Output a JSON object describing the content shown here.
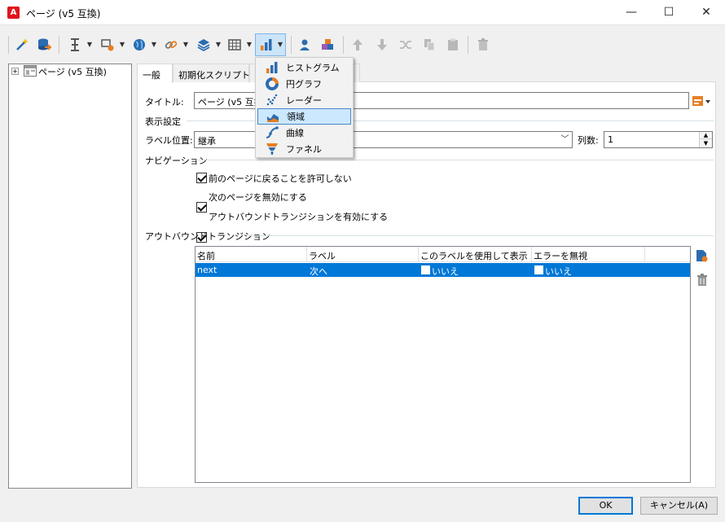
{
  "window": {
    "title": "ページ (v5 互換)",
    "minimize": "—",
    "maximize": "☐",
    "close": "✕"
  },
  "toolbar": {
    "icons": [
      "wand-icon",
      "database-icon",
      "text-cursor-icon",
      "shapes-icon",
      "globe-icon",
      "link-icon",
      "layers-icon",
      "grid-icon",
      "bar-chart-icon",
      "person-icon",
      "puzzle-icon",
      "arrow-up-icon",
      "arrow-down-icon",
      "shuffle-icon",
      "copy-icon",
      "paste-icon",
      "trash-icon"
    ]
  },
  "tree": {
    "root_label": "ページ (v5 互換)",
    "expander": "+"
  },
  "tabs": [
    {
      "label": "一般",
      "active": true
    },
    {
      "label": "初期化スクリプト",
      "active": false
    }
  ],
  "form": {
    "title_label": "タイトル:",
    "title_value": "ページ (v5 互換)",
    "display_group": "表示設定",
    "label_position_label": "ラベル位置:",
    "label_position_value": "継承",
    "columns_label": "列数:",
    "columns_value": "1",
    "nav_group": "ナビゲーション",
    "checkboxes": [
      {
        "label": "前のページに戻ることを許可しない",
        "checked": true
      },
      {
        "label": "次のページを無効にする",
        "checked": true
      },
      {
        "label": "アウトバウンドトランジションを有効にする",
        "checked": true
      }
    ],
    "outbound_group": "アウトバウンドトランジション"
  },
  "grid": {
    "columns": [
      "名前",
      "ラベル",
      "このラベルを使用して表示",
      "エラーを無視"
    ],
    "rows": [
      {
        "name": "next",
        "label": "次へ",
        "use_label": "いいえ",
        "ignore_errors": "いいえ"
      }
    ]
  },
  "menu": {
    "items": [
      {
        "label": "ヒストグラム",
        "icon": "histogram-icon",
        "selected": false
      },
      {
        "label": "円グラフ",
        "icon": "pie-chart-icon",
        "selected": false
      },
      {
        "label": "レーダー",
        "icon": "radar-icon",
        "selected": false
      },
      {
        "label": "領域",
        "icon": "area-chart-icon",
        "selected": true
      },
      {
        "label": "曲線",
        "icon": "curve-chart-icon",
        "selected": false
      },
      {
        "label": "ファネル",
        "icon": "funnel-icon",
        "selected": false
      }
    ]
  },
  "buttons": {
    "ok": "OK",
    "cancel": "キャンセル(A)"
  },
  "colors": {
    "accent": "#0078d7",
    "menu_selected": "#cce8ff",
    "toolbar_pressed": "#cce4f7"
  }
}
